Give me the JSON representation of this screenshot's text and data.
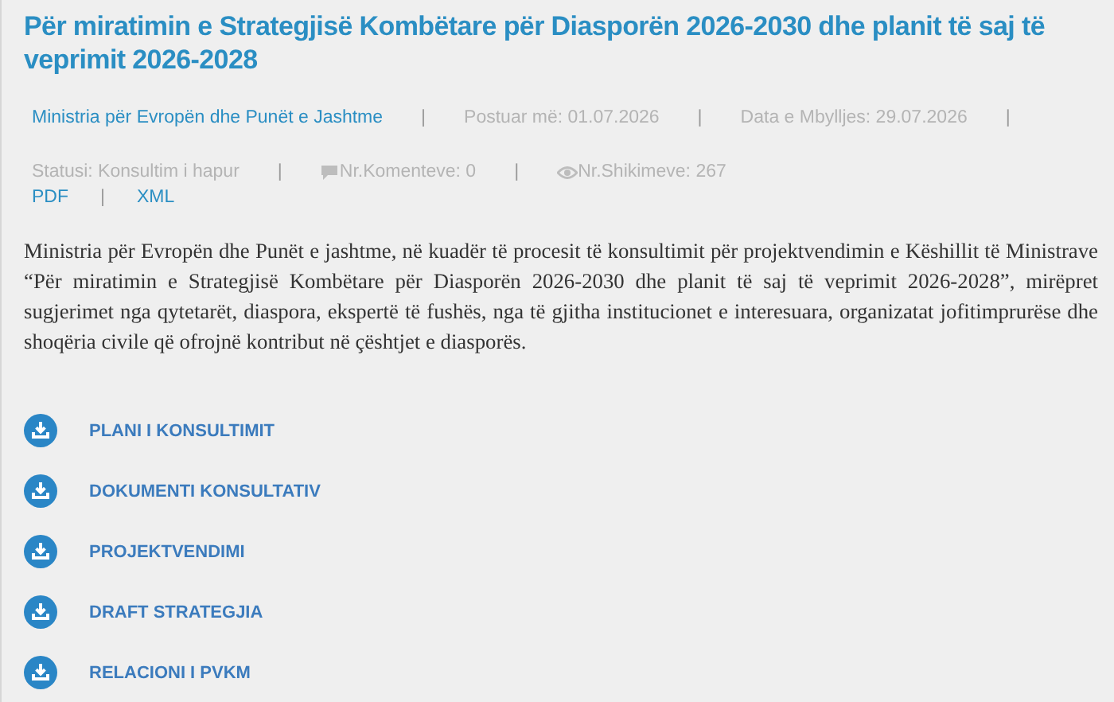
{
  "title": "Për miratimin e Strategjisë Kombëtare për Diasporën 2026-2030 dhe planit të saj të veprimit 2026-2028",
  "meta_rows": [
    [
      {
        "kind": "link",
        "text": "Ministria për Evropën dhe Punët e Jashtme"
      },
      {
        "kind": "separator",
        "text": "|"
      },
      {
        "kind": "text",
        "text": "Postuar më: 01.07.2026"
      },
      {
        "kind": "separator",
        "text": "|"
      },
      {
        "kind": "text",
        "text": "Data e Mbylljes: 29.07.2026"
      },
      {
        "kind": "separator",
        "text": "|"
      }
    ],
    [
      {
        "kind": "text",
        "text": "Statusi: Konsultim i hapur"
      },
      {
        "kind": "separator",
        "text": "|"
      },
      {
        "kind": "comment_count",
        "text": "Nr.Komenteve: 0"
      },
      {
        "kind": "separator",
        "text": "|"
      },
      {
        "kind": "view_count",
        "text": "Nr.Shikimeve: 267"
      }
    ],
    [
      {
        "kind": "link",
        "text": "PDF"
      },
      {
        "kind": "separator",
        "text": "|"
      },
      {
        "kind": "link",
        "text": "XML"
      }
    ]
  ],
  "description": "Ministria për Evropën dhe Punët e jashtme, në kuadër të procesit të konsultimit për projektvendimin e Këshillit të Ministrave “Për miratimin e Strategjisë Kombëtare për Diasporën 2026-2030 dhe planit të saj të veprimit 2026-2028”, mirëpret sugjerimet nga qytetarët, diaspora, ekspertë të fushës, nga të gjitha institucionet e interesuara, organizatat jofitimprurëse dhe shoqëria civile që ofrojnë kontribut në çështjet e diasporës.",
  "downloads": [
    "PLANI I KONSULTIMIT",
    "DOKUMENTI KONSULTATIV",
    "PROJEKTVENDIMI",
    "DRAFT STRATEGJIA",
    "RELACIONI I PVKM"
  ]
}
